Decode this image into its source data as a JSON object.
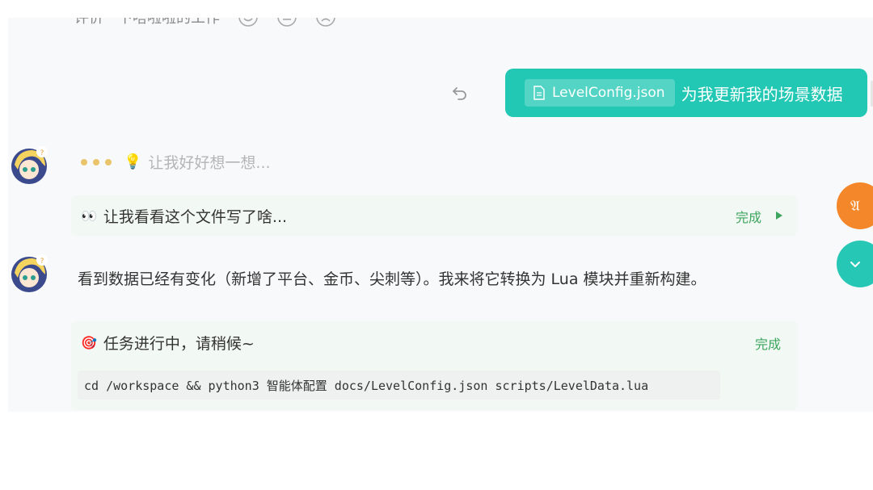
{
  "feedback": {
    "prompt": "评价一下嗒啦啦的工作",
    "options": [
      "smile-face-icon",
      "neutral-face-icon",
      "sad-face-icon"
    ]
  },
  "user_message": {
    "file_name": "LevelConfig.json",
    "text": "为我更新我的场景数据"
  },
  "thinking": {
    "text": "让我好好想一想..."
  },
  "step_read_file": {
    "emoji": "👀",
    "title": "让我看看这个文件写了啥...",
    "status": "完成"
  },
  "assistant_reply": {
    "text": "看到数据已经有变化（新增了平台、金币、尖刺等）。我来将它转换为 Lua 模块并重新构建。"
  },
  "task": {
    "emoji": "🎯",
    "title": "任务进行中，请稍候~",
    "status": "完成",
    "command": "cd /workspace && python3 智能体配置 docs/LevelConfig.json scripts/LevelData.lua"
  },
  "floating": {
    "bug_label": "𝔄"
  },
  "colors": {
    "accent": "#23c8b4",
    "status_done": "#3da55f",
    "fab_orange": "#f5872b",
    "card_bg": "#f2f8f3"
  }
}
